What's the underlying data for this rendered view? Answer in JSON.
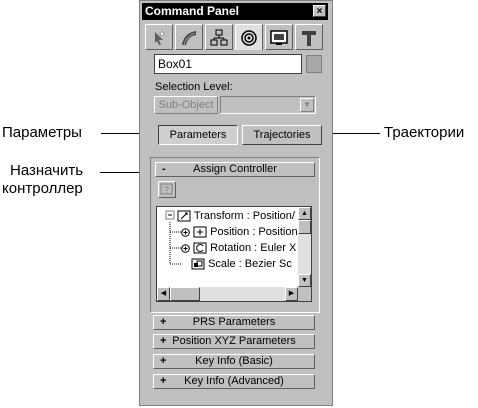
{
  "callouts": {
    "parameters": "Параметры",
    "trajectories": "Траектории",
    "assign_controller_line1": "Назначить",
    "assign_controller_line2": "контроллер"
  },
  "panel": {
    "title": "Command Panel",
    "close_glyph": "×",
    "tabs": [
      {
        "icon": "create-icon"
      },
      {
        "icon": "modify-icon"
      },
      {
        "icon": "hierarchy-icon"
      },
      {
        "icon": "motion-icon",
        "active": true
      },
      {
        "icon": "display-icon"
      },
      {
        "icon": "utilities-icon"
      }
    ],
    "object_name": "Box01",
    "object_color": "#a8a8a8",
    "selection_level_label": "Selection Level:",
    "sub_object_label": "Sub-Object",
    "parameters_button": "Parameters",
    "trajectories_button": "Trajectories"
  },
  "assign_controller": {
    "sign": "-",
    "title": "Assign Controller",
    "tree": [
      {
        "label": "Transform : Position/"
      },
      {
        "label": "Position : Position"
      },
      {
        "label": "Rotation : Euler X"
      },
      {
        "label": "Scale : Bezier Sc"
      }
    ]
  },
  "rollouts": [
    {
      "sign": "+",
      "title": "PRS Parameters"
    },
    {
      "sign": "+",
      "title": "Position XYZ Parameters"
    },
    {
      "sign": "+",
      "title": "Key Info (Basic)"
    },
    {
      "sign": "+",
      "title": "Key Info (Advanced)"
    }
  ]
}
